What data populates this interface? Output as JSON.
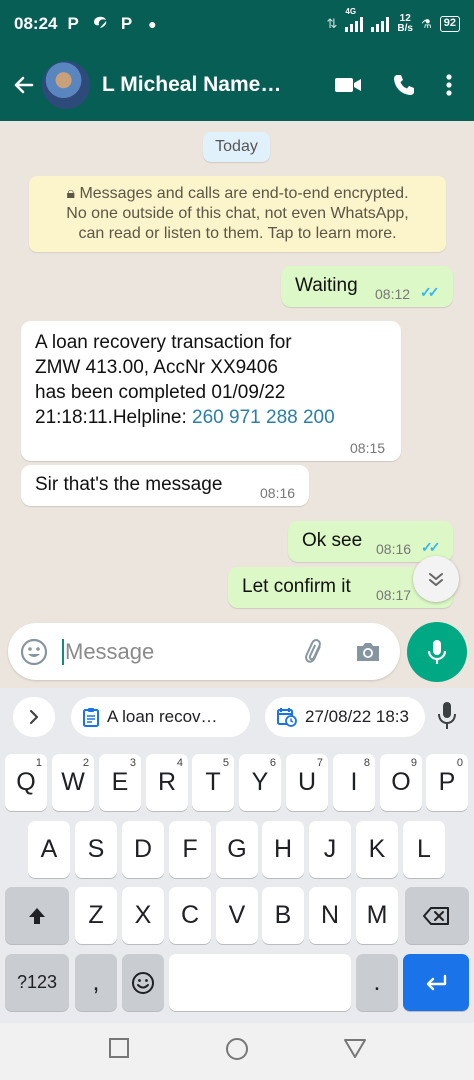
{
  "status_bar": {
    "time": "08:24",
    "app_icons": [
      "P",
      "P"
    ],
    "network_type": "4G",
    "net_speed_value": "12",
    "net_speed_unit": "B/s",
    "battery": "92"
  },
  "header": {
    "contact_name": "L Micheal Name…"
  },
  "chat": {
    "date_chip": "Today",
    "encryption_notice": [
      "Messages and calls are end-to-end encrypted.",
      "No one outside of this chat, not even WhatsApp,",
      "can read or listen to them. Tap to learn more."
    ],
    "messages": [
      {
        "direction": "out",
        "text": "Waiting",
        "time": "08:12",
        "read": true
      },
      {
        "direction": "in",
        "lines": [
          "A loan recovery transaction for",
          "ZMW 413.00, AccNr XX9406",
          "has been completed 01/09/22"
        ],
        "last_line_prefix": "21:18:11.Helpline: ",
        "phone": "260 971 288 200",
        "time": "08:15"
      },
      {
        "direction": "in",
        "text": "Sir that's the message",
        "time": "08:16"
      },
      {
        "direction": "out",
        "text": "Ok see",
        "time": "08:16",
        "read": true
      },
      {
        "direction": "out",
        "text": "Let confirm it",
        "time": "08:17",
        "read": true
      }
    ]
  },
  "compose": {
    "placeholder": "Message"
  },
  "keyboard": {
    "suggestions": [
      "A loan recov…",
      "27/08/22 18:3"
    ],
    "row1": [
      {
        "key": "Q",
        "hint": "1"
      },
      {
        "key": "W",
        "hint": "2"
      },
      {
        "key": "E",
        "hint": "3"
      },
      {
        "key": "R",
        "hint": "4"
      },
      {
        "key": "T",
        "hint": "5"
      },
      {
        "key": "Y",
        "hint": "6"
      },
      {
        "key": "U",
        "hint": "7"
      },
      {
        "key": "I",
        "hint": "8"
      },
      {
        "key": "O",
        "hint": "9"
      },
      {
        "key": "P",
        "hint": "0"
      }
    ],
    "row2": [
      "A",
      "S",
      "D",
      "F",
      "G",
      "H",
      "J",
      "K",
      "L"
    ],
    "row3": [
      "Z",
      "X",
      "C",
      "V",
      "B",
      "N",
      "M"
    ],
    "symbols_key": "?123",
    "comma_key": ",",
    "period_key": "."
  }
}
